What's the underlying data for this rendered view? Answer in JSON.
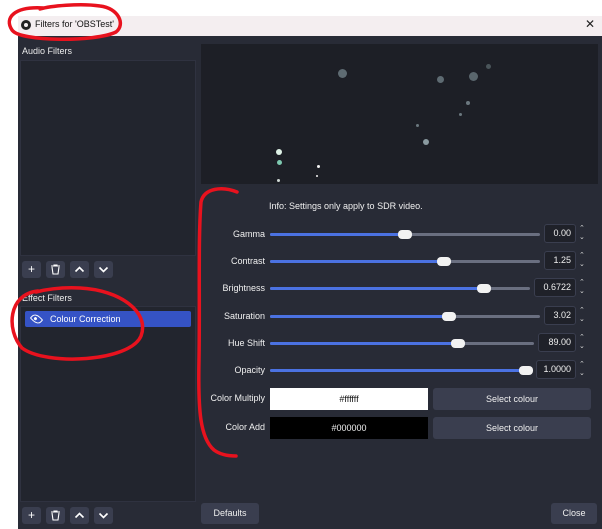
{
  "window": {
    "title": "Filters for 'OBSTest'",
    "close_glyph": "✕"
  },
  "audio_filters": {
    "label": "Audio Filters"
  },
  "effect_filters": {
    "label": "Effect Filters",
    "items": [
      {
        "label": "Colour Correction",
        "visible": true,
        "selected": true
      }
    ]
  },
  "toolbar": {
    "add": "+",
    "remove": "trash-icon",
    "up": "chevron-up-icon",
    "down": "chevron-down-icon"
  },
  "properties": {
    "info": "Info: Settings only apply to SDR video.",
    "sliders": [
      {
        "label": "Gamma",
        "value": "0.00",
        "fraction": 0.5
      },
      {
        "label": "Contrast",
        "value": "1.25",
        "fraction": 0.646
      },
      {
        "label": "Brightness",
        "value": "0.6722",
        "fraction": 0.823
      },
      {
        "label": "Saturation",
        "value": "3.02",
        "fraction": 0.663
      },
      {
        "label": "Hue Shift",
        "value": "89.00",
        "fraction": 0.712
      },
      {
        "label": "Opacity",
        "value": "1.0000",
        "fraction": 1.0
      }
    ],
    "color_multiply": {
      "label": "Color Multiply",
      "value": "#ffffff",
      "button": "Select colour"
    },
    "color_add": {
      "label": "Color Add",
      "value": "#000000",
      "button": "Select colour"
    }
  },
  "footer": {
    "defaults": "Defaults",
    "close": "Close"
  },
  "colors": {
    "accent": "#4b72e2",
    "selection": "#3553c5",
    "background": "#282b36",
    "annotation": "#e8121e"
  }
}
